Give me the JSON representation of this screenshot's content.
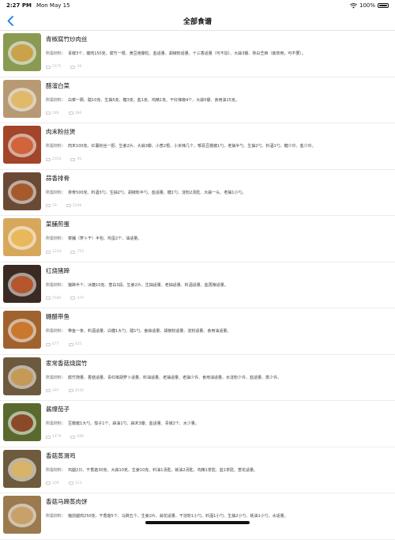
{
  "status": {
    "time": "2:27 PM",
    "date": "Mon May 15",
    "battery": "100%"
  },
  "nav": {
    "title": "全部食谱"
  },
  "ingredients_label": "所需材料：",
  "recipes": [
    {
      "name": "青椒腐竹炒肉丝",
      "ingredients": "青椒3个、瘦肉150克、腐竹一根、黄豆南瓣粒、盐适量、胡椒粉适量、十三香适量（可不加）、大蒜3瓣、熟白芝麻（装饰用，可不要）。",
      "views": "5575",
      "likes": "39",
      "colors": {
        "bg": "#8a9a52",
        "food": "#c9a24a"
      }
    },
    {
      "name": "醋溜白菜",
      "ingredients": "白菜一颗、醋10克、生抽5克、糖3克、盐1克、鸡精1克、干红辣椒4个、大蒜5瓣、食用油15克。",
      "views": "189",
      "likes": "286",
      "colors": {
        "bg": "#b79a73",
        "food": "#e0b96a"
      }
    },
    {
      "name": "肉末粉丝煲",
      "ingredients": "肉末100克、红薯粉丝一把、生姜2片、大蒜3瓣、小葱2根、小米辣几个、郫县豆瓣酱1勺、老抽半勺、生抽2勺、料酒1勺、糖少许、盐少许。",
      "views": "2354",
      "likes": "40",
      "colors": {
        "bg": "#a3452a",
        "food": "#d0643a"
      }
    },
    {
      "name": "蒜香排骨",
      "ingredients": "排骨500克、料酒3勺、生抽2勺、胡椒粉半勺、盐适量、糖1勺、淀粉2汤匙、大蒜一头、老抽1小勺。",
      "views": "79",
      "likes": "1249",
      "colors": {
        "bg": "#6b4a35",
        "food": "#a65a2c"
      }
    },
    {
      "name": "菜脯煎蛋",
      "ingredients": "菜脯（萝卜干）半包、鸡蛋2个、油适量。",
      "views": "1234",
      "likes": "753",
      "colors": {
        "bg": "#d7a85c",
        "food": "#e8b85a"
      }
    },
    {
      "name": "红烧猪蹄",
      "ingredients": "猪蹄半个、冰糖10克、葱白3段、生姜2片、生抽适量、老抽适量、料酒适量、盐再粮适量。",
      "views": "5580",
      "likes": "479",
      "colors": {
        "bg": "#3a2a22",
        "food": "#b5562c"
      }
    },
    {
      "name": "糖醋带鱼",
      "ingredients": "带鱼一条、料酒适量、白糖1大勺、醋1勺、姜蒜适量、胡椒粉适量、淀粉适量、食用油适量。",
      "views": "477",
      "likes": "435",
      "colors": {
        "bg": "#a0622e",
        "food": "#c9782e"
      }
    },
    {
      "name": "家常香菇烧腐竹",
      "ingredients": "腐竹随量、香菇适量、青红椒胡萝卜适量、料油适量、老抽适量、老抽少许、食用油适量、水淀粉少许、盐适量、蒸少许。",
      "views": "397",
      "likes": "3430",
      "colors": {
        "bg": "#6d5a3e",
        "food": "#c49a56"
      }
    },
    {
      "name": "酱爆茄子",
      "ingredients": "豆瓣酱1大勺、茄子1个、蒜油1勺、蒜末3瓣、盐适量、青椒2个、水少量。",
      "views": "1479",
      "likes": "699",
      "colors": {
        "bg": "#5a6a2e",
        "food": "#8a4a2a"
      }
    },
    {
      "name": "香菇蒸滑鸡",
      "ingredients": "鸡腿2只、干香菇30克、大蒜10克、生姜10克、料油1汤匙、蚝油2汤匙、鸡精1茶匙、盐1茶匙、葱花适量。",
      "views": "109",
      "likes": "123",
      "colors": {
        "bg": "#6e5a3c",
        "food": "#d7b46a"
      }
    },
    {
      "name": "香菇马蹄蒸肉饼",
      "ingredients": "猪前腿肉250克、干香菇5个、马蹄五个、生姜2片、蒜花适量、干淀粉1小勺、料酒1小勺、生抽2小勺、蚝油1小勺、水适量。",
      "views": "",
      "likes": "",
      "colors": {
        "bg": "#9a7a4e",
        "food": "#c8a06a"
      }
    }
  ]
}
